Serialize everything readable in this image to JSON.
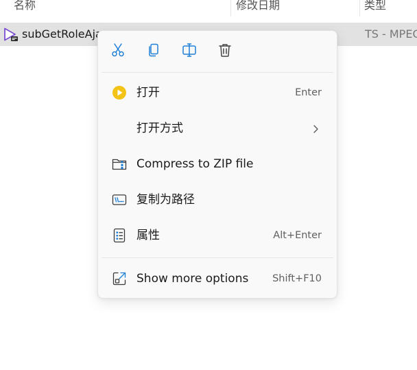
{
  "columns": {
    "name": "名称",
    "date_modified": "修改日期",
    "type": "类型"
  },
  "file": {
    "name": "subGetRoleAja",
    "type": "TS - MPEG"
  },
  "context_menu": {
    "quick_actions": [
      "cut-icon",
      "copy-icon",
      "rename-icon",
      "delete-icon"
    ],
    "items": [
      {
        "label": "打开",
        "shortcut": "Enter",
        "icon": "play-icon"
      },
      {
        "label": "打开方式",
        "shortcut": "",
        "icon": "",
        "has_submenu": true
      },
      {
        "label": "Compress to ZIP file",
        "shortcut": "",
        "icon": "zip-folder-icon"
      },
      {
        "label": "复制为路径",
        "shortcut": "",
        "icon": "copy-path-icon"
      },
      {
        "label": "属性",
        "shortcut": "Alt+Enter",
        "icon": "properties-icon"
      },
      {
        "label": "Show more options",
        "shortcut": "Shift+F10",
        "icon": "more-options-icon"
      }
    ]
  },
  "colors": {
    "accent": "#1f7fd6",
    "play_yellow": "#f3c316",
    "selection": "#e2e2e2",
    "menu_bg": "#f9f9f9"
  }
}
